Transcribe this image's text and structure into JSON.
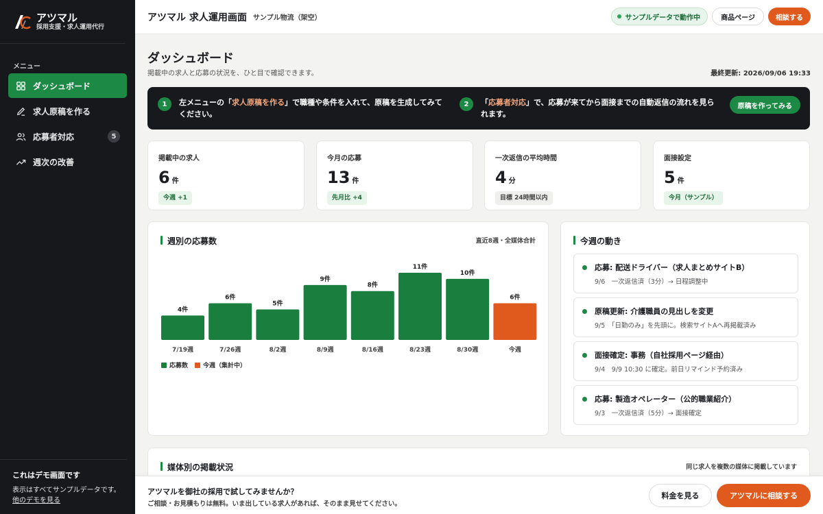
{
  "brand": {
    "name": "アツマル",
    "sub": "採用支援・求人運用代行"
  },
  "sidebar": {
    "menu_title": "メニュー",
    "items": [
      {
        "label": "ダッシュボード",
        "icon": "grid-icon"
      },
      {
        "label": "求人原稿を作る",
        "icon": "pencil-icon"
      },
      {
        "label": "応募者対応",
        "icon": "users-icon",
        "badge": "5"
      },
      {
        "label": "週次の改善",
        "icon": "trend-up-icon"
      }
    ],
    "demo": {
      "title": "これはデモ画面です",
      "text": "表示はすべてサンプルデータです。",
      "link": "他のデモを見る"
    }
  },
  "header": {
    "title": "アツマル 求人運用画面",
    "sub": "サンプル物流（架空）",
    "live": "サンプルデータで動作中",
    "product_btn": "商品ページ",
    "consult_btn": "相談する"
  },
  "page": {
    "title": "ダッシュボード",
    "desc": "掲載中の求人と応募の状況を、ひと目で確認できます。",
    "last_update": "最終更新: 2026/09/06 19:33"
  },
  "guide": {
    "step1": {
      "num": "1",
      "pre": "左メニューの「",
      "hl": "求人原稿を作る",
      "post": "」で職種や条件を入れて、原稿を生成してみてください。"
    },
    "step2": {
      "num": "2",
      "pre": "「",
      "hl": "応募者対応",
      "post": "」で、応募が来てから面接までの自動返信の流れを見られます。"
    },
    "button": "原稿を作ってみる"
  },
  "kpis": [
    {
      "label": "掲載中の求人",
      "value": "6",
      "unit": "件",
      "tag": "今週 +1",
      "tone": "green"
    },
    {
      "label": "今月の応募",
      "value": "13",
      "unit": "件",
      "tag": "先月比 +4",
      "tone": "green"
    },
    {
      "label": "一次返信の平均時間",
      "value": "4",
      "unit": "分",
      "tag": "目標 24時間以内",
      "tone": "gray"
    },
    {
      "label": "面接設定",
      "value": "5",
      "unit": "件",
      "tag": "今月（サンプル）",
      "tone": "green"
    }
  ],
  "weekly_card": {
    "title": "週別の応募数",
    "note": "直近8週・全媒体合計"
  },
  "chart_data": {
    "type": "bar",
    "categories": [
      "7/19週",
      "7/26週",
      "8/2週",
      "8/9週",
      "8/16週",
      "8/23週",
      "8/30週",
      "今週"
    ],
    "values": [
      4,
      6,
      5,
      9,
      8,
      11,
      10,
      6
    ],
    "value_suffix": "件",
    "ylim": [
      0,
      11
    ],
    "colors": {
      "main": "#1a7f3e",
      "current": "#e05a1e"
    },
    "legend": [
      {
        "label": "応募数",
        "color": "#1a7f3e"
      },
      {
        "label": "今週（集計中）",
        "color": "#e05a1e"
      }
    ],
    "grid": false
  },
  "activity": {
    "title": "今週の動き",
    "items": [
      {
        "title": "応募: 配送ドライバー（求人まとめサイトB）",
        "sub": "9/6　一次返信済（3分）→ 日程調整中"
      },
      {
        "title": "原稿更新: 介護職員の見出しを変更",
        "sub": "9/5　「日勤のみ」を先頭に。検索サイトAへ再掲載済み"
      },
      {
        "title": "面接確定: 事務（自社採用ページ経由）",
        "sub": "9/4　9/9 10:30 に確定。前日リマインド予約済み"
      },
      {
        "title": "応募: 製造オペレーター（公的職業紹介）",
        "sub": "9/3　一次返信済（5分）→ 面接確定"
      }
    ]
  },
  "media_card": {
    "title": "媒体別の掲載状況",
    "note": "同じ求人を複数の媒体に掲載しています"
  },
  "footer": {
    "title": "アツマルを御社の採用で試してみませんか？",
    "sub": "ご相談・お見積もりは無料。いま出している求人があれば、そのまま見せてください。",
    "price_btn": "料金を見る",
    "consult_btn": "アツマルに相談する"
  }
}
